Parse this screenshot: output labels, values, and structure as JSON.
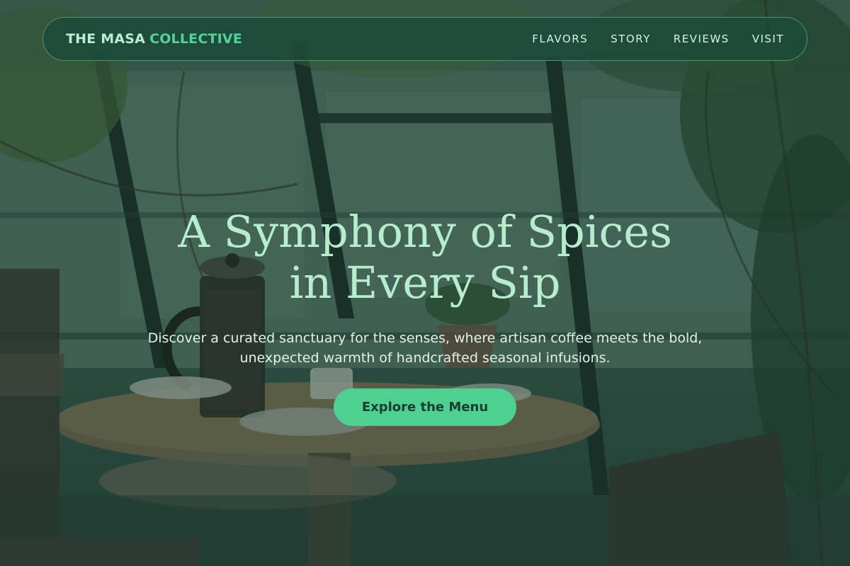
{
  "brand": {
    "name": "THE MASA",
    "accent": "COLLECTIVE"
  },
  "nav": {
    "items": [
      {
        "label": "FLAVORS"
      },
      {
        "label": "STORY"
      },
      {
        "label": "REVIEWS"
      },
      {
        "label": "VISIT"
      }
    ]
  },
  "hero": {
    "title": "A Symphony of Spices in Every Sip",
    "subtitle": "Discover a curated sanctuary for the senses, where artisan coffee meets the bold, unexpected warmth of handcrafted seasonal infusions.",
    "cta_label": "Explore the Menu",
    "background": "cafe-greenhouse-photo"
  },
  "colors": {
    "accent": "#4fd093",
    "title_text": "#b7edcd",
    "overlay": "#163a2d"
  }
}
